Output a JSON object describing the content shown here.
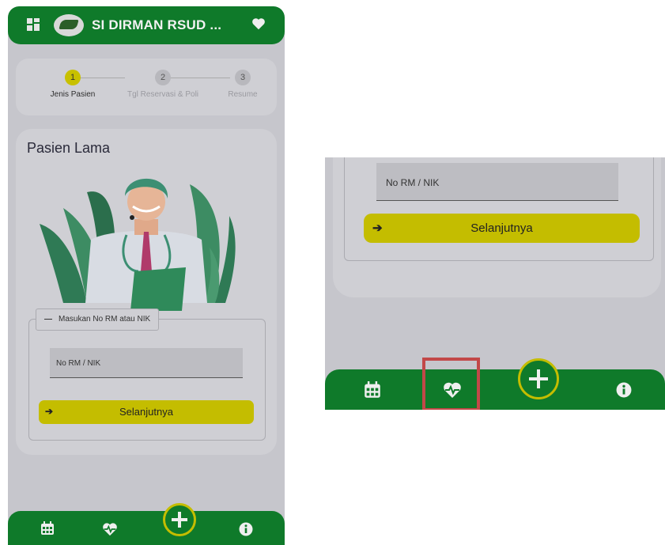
{
  "app": {
    "title": "SI DIRMAN RSUD ..."
  },
  "steps": [
    {
      "number": "1",
      "label": "Jenis Pasien"
    },
    {
      "number": "2",
      "label": "Tgl Reservasi & Poli"
    },
    {
      "number": "3",
      "label": "Resume"
    }
  ],
  "card": {
    "title": "Pasien Lama",
    "legend": "Masukan No RM atau NIK",
    "input_placeholder": "No RM / NIK",
    "next_button": "Selanjutnya"
  },
  "icons": {
    "menu": "grid-icon",
    "favorite": "heart-icon",
    "calendar": "calendar-icon",
    "health": "heartbeat-icon",
    "add": "plus-icon",
    "info": "info-icon"
  },
  "colors": {
    "brand_green": "#0f7a2a",
    "accent_yellow": "#c4bd00",
    "highlight_red": "#c24848"
  }
}
